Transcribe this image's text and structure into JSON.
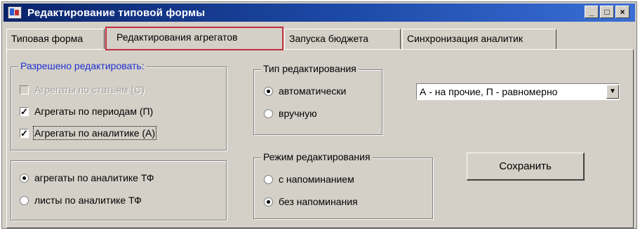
{
  "window": {
    "title": "Редактирование типовой формы",
    "controls": {
      "minimize": "_",
      "maximize": "□",
      "close": "×"
    }
  },
  "tabs": [
    {
      "label": "Типовая форма",
      "active": false
    },
    {
      "label": "Редактирования агрегатов",
      "active": true
    },
    {
      "label": "Запуска бюджета",
      "active": false
    },
    {
      "label": "Синхронизация аналитик",
      "active": false
    }
  ],
  "allowed_group": {
    "legend": "Разрешено редактировать:",
    "items": [
      {
        "label": "Агрегаты по статьям (С)",
        "checked": false,
        "disabled": true
      },
      {
        "label": "Агрегаты по периодам (П)",
        "checked": true,
        "disabled": false
      },
      {
        "label": "Агрегаты по аналитике (А)",
        "checked": true,
        "disabled": false
      }
    ]
  },
  "scope_group": {
    "items": [
      {
        "label": "агрегаты по аналитике ТФ",
        "selected": true
      },
      {
        "label": "листы по аналитике ТФ",
        "selected": false
      }
    ]
  },
  "edit_type_group": {
    "legend": "Тип редактирования",
    "items": [
      {
        "label": "автоматически",
        "selected": true
      },
      {
        "label": "вручную",
        "selected": false
      }
    ]
  },
  "distribution_select": {
    "value": "А - на прочие, П - равномерно"
  },
  "edit_mode_group": {
    "legend": "Режим редактирования",
    "items": [
      {
        "label": "с напоминанием",
        "selected": false
      },
      {
        "label": "без напоминания",
        "selected": true
      }
    ]
  },
  "save_button": {
    "label": "Сохранить"
  },
  "icons": {
    "check": "✓",
    "dropdown_arrow": "▼"
  },
  "colors": {
    "title_bar": "#0a246a",
    "legend_blue": "#2030d0",
    "active_tab_highlight": "#c0303c"
  }
}
